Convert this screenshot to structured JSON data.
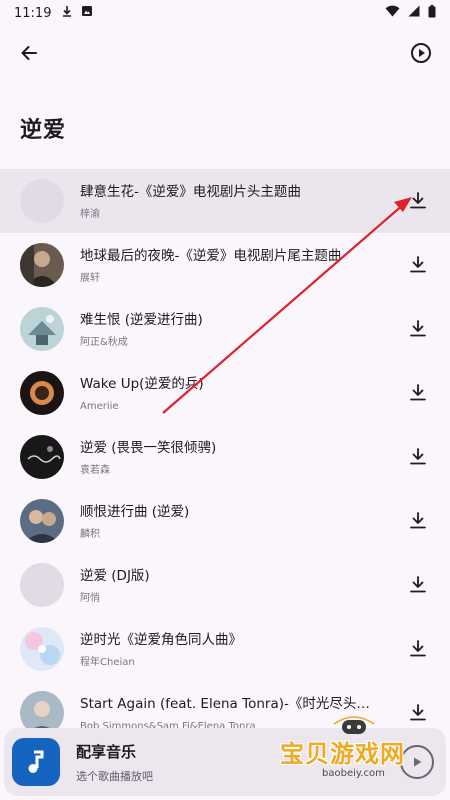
{
  "status_bar": {
    "time": "11:19"
  },
  "page": {
    "title": "逆爱"
  },
  "songs": [
    {
      "title": "肆意生花-《逆爱》电视剧片头主题曲",
      "artist": "梓渝",
      "active": true
    },
    {
      "title": "地球最后的夜晚-《逆爱》电视剧片尾主题曲",
      "artist": "展轩"
    },
    {
      "title": "难生恨 (逆爱进行曲)",
      "artist": "阿正&秋成"
    },
    {
      "title": "Wake Up(逆爱的兵)",
      "artist": "Ameriie"
    },
    {
      "title": "逆爱 (畏畏一笑很倾骋)",
      "artist": "袁若森"
    },
    {
      "title": "顺恨进行曲 (逆爱)",
      "artist": "麟积"
    },
    {
      "title": "逆爱 (DJ版)",
      "artist": "阿悄"
    },
    {
      "title": "逆时光《逆爱角色同人曲》",
      "artist": "程年Cheian"
    },
    {
      "title": "Start Again (feat. Elena Tonra)-《时光尽头的恋…",
      "artist": "Bob Simmons&Sam Fi&Elena Tonra"
    }
  ],
  "player": {
    "title": "配享音乐",
    "subtitle": "选个歌曲播放吧"
  },
  "watermark": {
    "text": "宝贝游戏网",
    "url": "baobeiy.com"
  },
  "icons": {
    "back": "arrow-left-icon",
    "play_circle": "play-circle-icon",
    "download": "download-icon",
    "music_note": "music-note-icon"
  },
  "colors": {
    "background": "#fbf6fb",
    "active_row": "#ebe6ee",
    "player_art": "#1565c0",
    "annotation_arrow": "#e0202a",
    "watermark": "#f1a923"
  }
}
